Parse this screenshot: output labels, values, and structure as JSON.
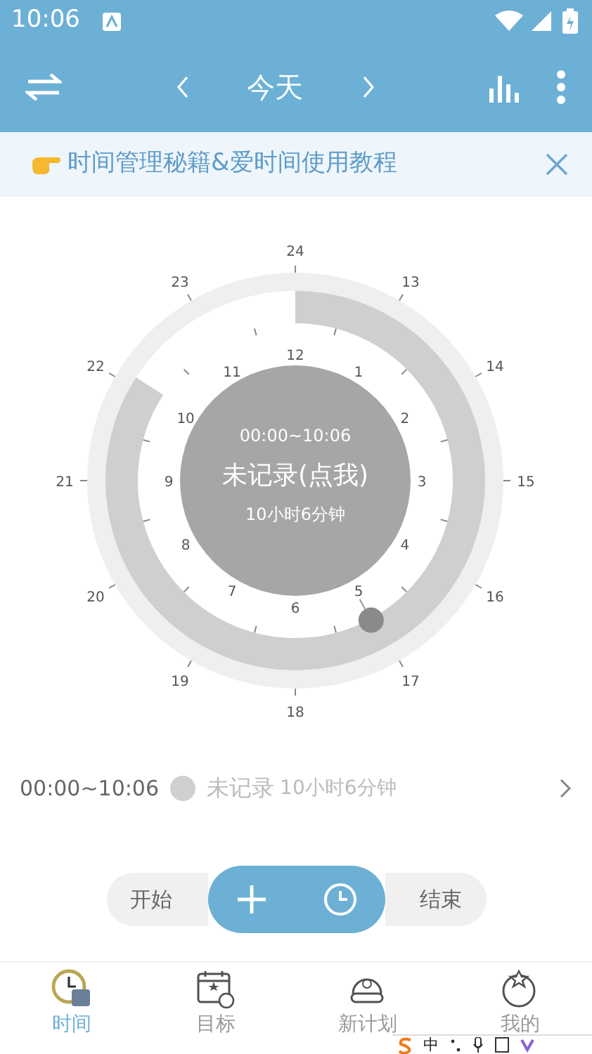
{
  "status_bar": {
    "time": "10:06"
  },
  "toolbar": {
    "title": "今天"
  },
  "banner": {
    "text": "时间管理秘籍&爱时间使用教程"
  },
  "clock": {
    "outer_labels": [
      "13",
      "14",
      "15",
      "16",
      "17",
      "18",
      "19",
      "20",
      "21",
      "22",
      "23",
      "24"
    ],
    "inner_labels": [
      "1",
      "2",
      "3",
      "4",
      "5",
      "6",
      "7",
      "8",
      "9",
      "10",
      "11",
      "12"
    ],
    "range": "00:00~10:06",
    "status": "未记录(点我)",
    "duration": "10小时6分钟"
  },
  "record": {
    "range": "00:00~10:06",
    "color": "#d0d0d0",
    "label": "未记录",
    "duration": "10小时6分钟"
  },
  "controls": {
    "start": "开始",
    "end": "结束"
  },
  "tabs": [
    {
      "label": "时间",
      "selected": true
    },
    {
      "label": "目标",
      "selected": false
    },
    {
      "label": "新计划",
      "selected": false
    },
    {
      "label": "我的",
      "selected": false
    }
  ],
  "ime_bar": {
    "text": "中"
  }
}
